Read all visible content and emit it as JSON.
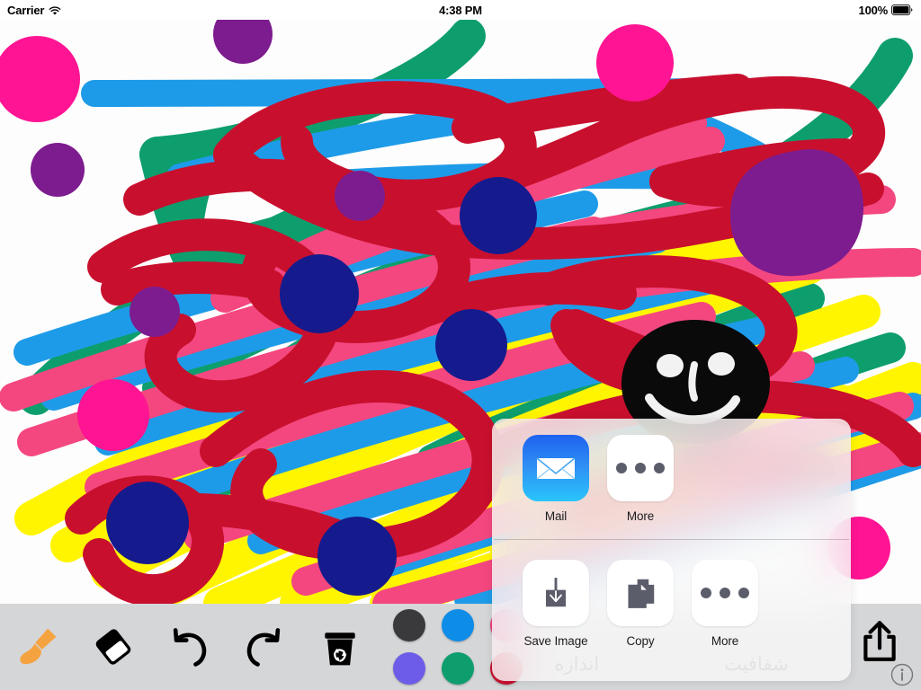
{
  "status_bar": {
    "carrier": "Carrier",
    "wifi_icon": "wifi-icon",
    "time": "4:38 PM",
    "battery_percent": "100%",
    "battery_icon": "battery-full-icon"
  },
  "toolbar": {
    "tools": [
      {
        "name": "brush-tool",
        "icon": "paintbrush-icon",
        "color": "#F5A340"
      },
      {
        "name": "eraser-tool",
        "icon": "eraser-icon",
        "color": "#000000"
      },
      {
        "name": "undo-button",
        "icon": "undo-arrow-icon",
        "color": "#000000"
      },
      {
        "name": "redo-button",
        "icon": "redo-arrow-icon",
        "color": "#000000"
      },
      {
        "name": "clear-button",
        "icon": "trash-recycle-icon",
        "color": "#000000"
      }
    ],
    "colors": [
      {
        "name": "swatch-dark",
        "hex": "#3a3a3c"
      },
      {
        "name": "swatch-blue",
        "hex": "#0d8ce8"
      },
      {
        "name": "swatch-pink",
        "hex": "#ed3a7f"
      },
      {
        "name": "swatch-purple",
        "hex": "#6c5ce7"
      },
      {
        "name": "swatch-green",
        "hex": "#0e9e6e"
      },
      {
        "name": "swatch-red",
        "hex": "#c8102e"
      }
    ],
    "share_icon": "share-export-icon",
    "info_icon": "info-circle-icon",
    "background": "#d5d6d8"
  },
  "share_sheet": {
    "apps": [
      {
        "label": "Mail",
        "icon": "mail-envelope-icon"
      },
      {
        "label": "More",
        "icon": "ellipsis-icon"
      }
    ],
    "actions": [
      {
        "label": "Save Image",
        "icon": "save-download-icon"
      },
      {
        "label": "Copy",
        "icon": "copy-documents-icon"
      },
      {
        "label": "More",
        "icon": "ellipsis-icon"
      }
    ],
    "ghost_labels": [
      "شفافیت",
      "اندازه"
    ]
  },
  "canvas": {
    "background": "#fdfdfd",
    "palette": {
      "magenta": "#ff1493",
      "pink": "#f4477f",
      "purple": "#7d1c8e",
      "sky_blue": "#1e9be8",
      "teal_green": "#0e9e6e",
      "yellow": "#fff500",
      "crimson": "#c8102e",
      "navy": "#151b8d",
      "black": "#0a0a0a"
    },
    "artwork_description": "Freehand multicolor scribble drawing with a black smiley face"
  }
}
